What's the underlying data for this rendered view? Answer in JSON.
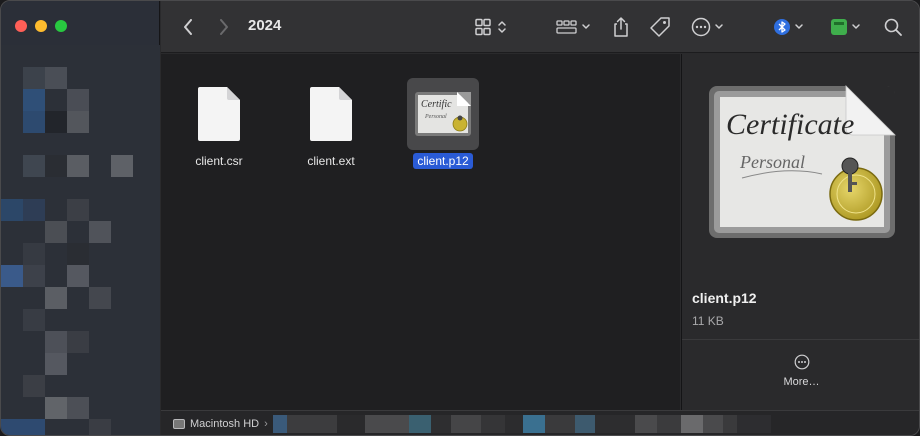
{
  "window": {
    "title": "2024"
  },
  "toolbar": {
    "back_icon": "chevron-left-icon",
    "forward_icon": "chevron-right-icon",
    "view_icon": "grid-view-icon",
    "group_icon": "group-icon",
    "share_icon": "share-icon",
    "tag_icon": "tag-icon",
    "action_icon": "ellipsis-circle-icon",
    "app1_icon": "bluetooth-icon",
    "app2_icon": "green-app-icon",
    "search_icon": "search-icon"
  },
  "files": [
    {
      "name": "client.csr",
      "type": "document",
      "selected": false
    },
    {
      "name": "client.ext",
      "type": "document",
      "selected": false
    },
    {
      "name": "client.p12",
      "type": "certificate",
      "selected": true
    }
  ],
  "preview": {
    "name": "client.p12",
    "size": "11 KB",
    "more_label": "More…",
    "cert_text_1": "Certificate",
    "cert_text_2": "Personal"
  },
  "pathbar": {
    "drive": "Macintosh HD",
    "separator": "›"
  },
  "colors": {
    "selection": "#2a5bd6",
    "close": "#ff5f57",
    "minimize": "#febc2e",
    "maximize": "#28c840"
  }
}
